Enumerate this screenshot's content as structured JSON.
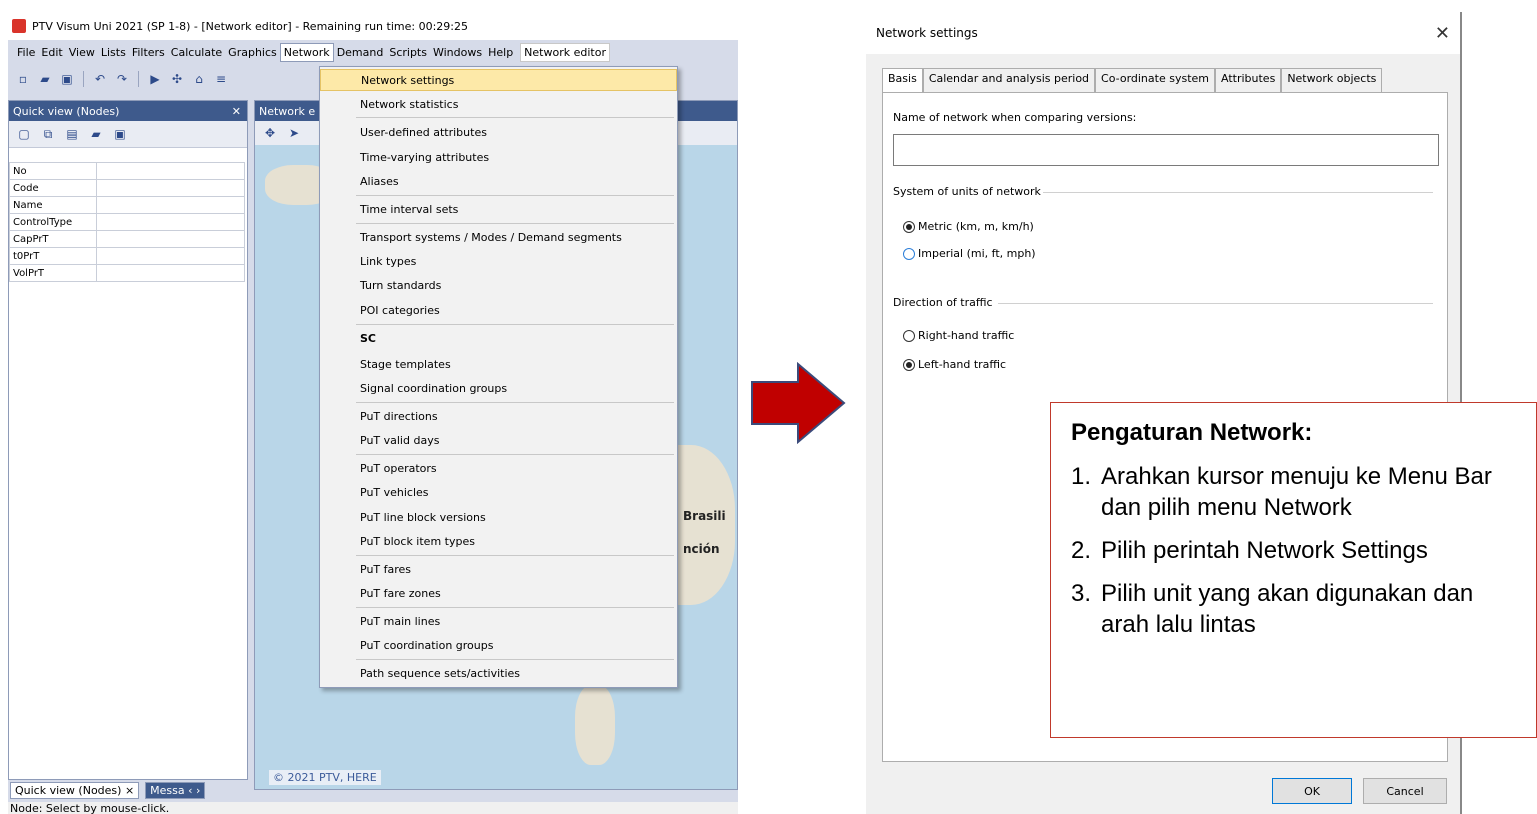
{
  "app": {
    "title": "PTV Visum Uni 2021 (SP 1-8) - [Network editor] - Remaining run time: 00:29:25",
    "menu": [
      "File",
      "Edit",
      "View",
      "Lists",
      "Filters",
      "Calculate",
      "Graphics",
      "Network",
      "Demand",
      "Scripts",
      "Windows",
      "Help",
      "Network editor"
    ],
    "active_menu": "Network",
    "quick_view": {
      "title": "Quick view (Nodes)",
      "pin": "✕",
      "rows": [
        "No",
        "Code",
        "Name",
        "ControlType",
        "CapPrT",
        "t0PrT",
        "VolPrT"
      ]
    },
    "map": {
      "header": "Network e",
      "labels": [
        "Brasili",
        "nción"
      ],
      "copyright": "© 2021 PTV, HERE"
    },
    "bottom_tabs": [
      "Quick view (Nodes) ×",
      "Messa ‹ ›"
    ],
    "status": "Node: Select by mouse-click.",
    "network_menu": [
      {
        "label": "Network settings",
        "highlight": true
      },
      {
        "label": "Network statistics"
      },
      {
        "label": "User-defined attributes"
      },
      {
        "label": "Time-varying attributes"
      },
      {
        "label": "Aliases"
      },
      {
        "label": "Time interval sets"
      },
      {
        "label": "Transport systems / Modes / Demand segments"
      },
      {
        "label": "Link types"
      },
      {
        "label": "Turn standards"
      },
      {
        "label": "POI categories"
      },
      {
        "label": "SC"
      },
      {
        "label": "Stage templates"
      },
      {
        "label": "Signal coordination groups"
      },
      {
        "label": "PuT directions"
      },
      {
        "label": "PuT valid days"
      },
      {
        "label": "PuT operators"
      },
      {
        "label": "PuT vehicles"
      },
      {
        "label": "PuT line block versions"
      },
      {
        "label": "PuT block item types"
      },
      {
        "label": "PuT fares"
      },
      {
        "label": "PuT fare zones"
      },
      {
        "label": "PuT main lines"
      },
      {
        "label": "PuT coordination groups"
      },
      {
        "label": "Path sequence sets/activities"
      }
    ]
  },
  "dialog": {
    "title": "Network settings",
    "close": "✕",
    "tabs": [
      "Basis",
      "Calendar and analysis period",
      "Co-ordinate system",
      "Attributes",
      "Network objects"
    ],
    "active_tab": "Basis",
    "name_label": "Name of network when comparing versions:",
    "name_value": "",
    "units_group": "System of units of network",
    "units_options": [
      {
        "label": "Metric (km, m, km/h)",
        "checked": true
      },
      {
        "label": "Imperial (mi, ft, mph)",
        "checked": false
      }
    ],
    "traffic_group": "Direction of traffic",
    "traffic_options": [
      {
        "label": "Right-hand traffic",
        "checked": false
      },
      {
        "label": "Left-hand traffic",
        "checked": true
      }
    ],
    "ok": "OK",
    "cancel": "Cancel"
  },
  "callout": {
    "title": "Pengaturan Network:",
    "steps": [
      {
        "num": "1.",
        "text": "Arahkan kursor menuju ke Menu Bar dan pilih menu Network"
      },
      {
        "num": "2.",
        "text": "Pilih perintah Network Settings"
      },
      {
        "num": "3.",
        "text": "Pilih unit yang akan digunakan dan arah lalu lintas"
      }
    ]
  },
  "colors": {
    "arrow": "#c00000",
    "callout_border": "#c0392b",
    "menu_highlight": "#fde9a8",
    "panel_header": "#3e5a8c"
  }
}
